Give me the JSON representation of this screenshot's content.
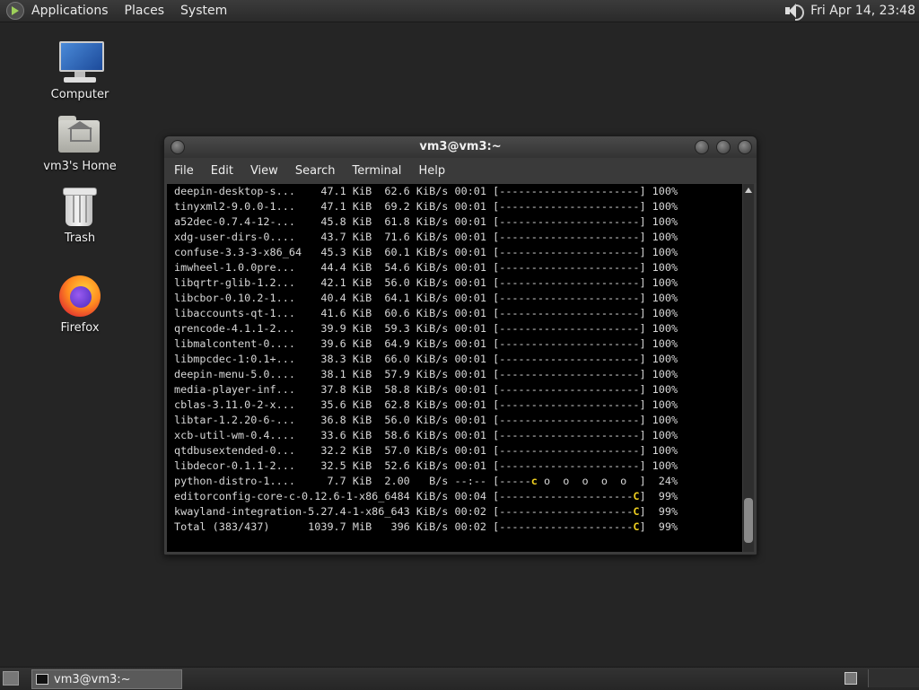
{
  "top_panel": {
    "menus": [
      "Applications",
      "Places",
      "System"
    ],
    "clock": "Fri Apr 14, 23:48"
  },
  "desktop_icons": [
    {
      "label": "Computer",
      "icon": "computer-icon"
    },
    {
      "label": "vm3's Home",
      "icon": "home-folder-icon"
    },
    {
      "label": "Trash",
      "icon": "trash-icon"
    },
    {
      "label": "Firefox",
      "icon": "firefox-icon"
    }
  ],
  "terminal": {
    "title": "vm3@vm3:~",
    "menu": [
      "File",
      "Edit",
      "View",
      "Search",
      "Terminal",
      "Help"
    ],
    "lines": [
      "deepin-desktop-s...    47.1 KiB  62.6 KiB/s 00:01 [----------------------] 100%",
      "tinyxml2-9.0.0-1...    47.1 KiB  69.2 KiB/s 00:01 [----------------------] 100%",
      "a52dec-0.7.4-12-...    45.8 KiB  61.8 KiB/s 00:01 [----------------------] 100%",
      "xdg-user-dirs-0....    43.7 KiB  71.6 KiB/s 00:01 [----------------------] 100%",
      "confuse-3.3-3-x86_64   45.3 KiB  60.1 KiB/s 00:01 [----------------------] 100%",
      "imwheel-1.0.0pre...    44.4 KiB  54.6 KiB/s 00:01 [----------------------] 100%",
      "libqrtr-glib-1.2...    42.1 KiB  56.0 KiB/s 00:01 [----------------------] 100%",
      "libcbor-0.10.2-1...    40.4 KiB  64.1 KiB/s 00:01 [----------------------] 100%",
      "libaccounts-qt-1...    41.6 KiB  60.6 KiB/s 00:01 [----------------------] 100%",
      "qrencode-4.1.1-2...    39.9 KiB  59.3 KiB/s 00:01 [----------------------] 100%",
      "libmalcontent-0....    39.6 KiB  64.9 KiB/s 00:01 [----------------------] 100%",
      "libmpcdec-1:0.1+...    38.3 KiB  66.0 KiB/s 00:01 [----------------------] 100%",
      "deepin-menu-5.0....    38.1 KiB  57.9 KiB/s 00:01 [----------------------] 100%",
      "media-player-inf...    37.8 KiB  58.8 KiB/s 00:01 [----------------------] 100%",
      "cblas-3.11.0-2-x...    35.6 KiB  62.8 KiB/s 00:01 [----------------------] 100%",
      "libtar-1.2.20-6-...    36.8 KiB  56.0 KiB/s 00:01 [----------------------] 100%",
      "xcb-util-wm-0.4....    33.6 KiB  58.6 KiB/s 00:01 [----------------------] 100%",
      "qtdbusextended-0...    32.2 KiB  57.0 KiB/s 00:01 [----------------------] 100%",
      "libdecor-0.1.1-2...    32.5 KiB  52.6 KiB/s 00:01 [----------------------] 100%"
    ],
    "progress_lines": [
      {
        "pre": "python-distro-1....     7.7 KiB  2.00   B/s --:-- [-----",
        "mark": "c",
        "post": " o  o  o  o  o  ]  24%"
      },
      {
        "pre": "editorconfig-core-c-0.12.6-1-x86_6484 KiB/s 00:04 [---------------------",
        "mark": "C",
        "post": "]  99%"
      },
      {
        "pre": "kwayland-integration-5.27.4-1-x86_643 KiB/s 00:02 [---------------------",
        "mark": "C",
        "post": "]  99%"
      },
      {
        "pre": "Total (383/437)      1039.7 MiB   396 KiB/s 00:02 [---------------------",
        "mark": "C",
        "post": "]  99%"
      }
    ]
  },
  "taskbar": {
    "item": "vm3@vm3:~"
  }
}
